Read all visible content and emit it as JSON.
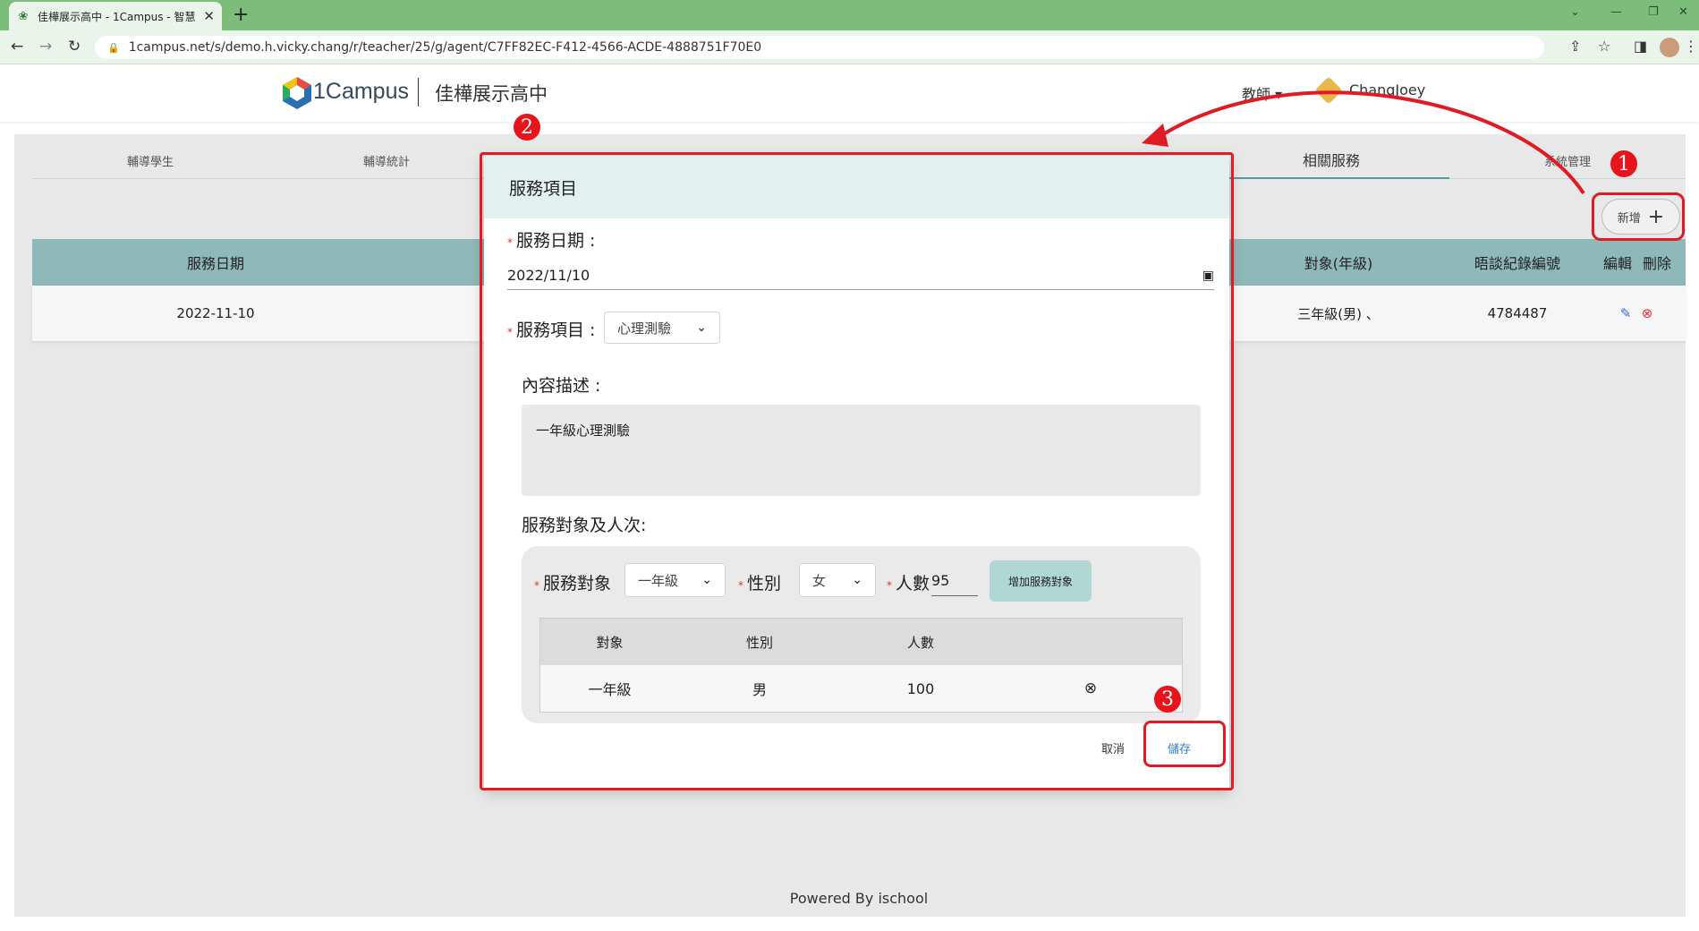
{
  "browser": {
    "tab_title": "佳樺展示高中 - 1Campus - 智慧",
    "tab_close": "✕",
    "new_tab": "+",
    "url": "1campus.net/s/demo.h.vicky.chang/r/teacher/25/g/agent/C7FF82EC-F412-4566-ACDE-4888751F70E0",
    "window_controls": [
      "⌄",
      "—",
      "❐",
      "✕"
    ]
  },
  "header": {
    "brand": "1Campus",
    "school": "佳樺展示高中",
    "role": "教師 ▾",
    "username": "ChangJoey"
  },
  "nav": {
    "tabs": [
      {
        "label": "輔導學生"
      },
      {
        "label": "輔導統計"
      },
      {
        "label": "…"
      },
      {
        "label": "…"
      },
      {
        "label": "…"
      },
      {
        "label": "相關服務"
      },
      {
        "label": "系統管理"
      }
    ]
  },
  "toolbar": {
    "add_label": "新增",
    "add_icon": "+"
  },
  "table": {
    "headers": [
      "服務日期",
      "對象(年級)",
      "晤談紀錄編號",
      "編輯",
      "刪除"
    ],
    "rows": [
      {
        "date": "2022-11-10",
        "target": "三年級(男) 、",
        "record_id": "4784487",
        "edit_icon": "✎",
        "delete_icon": "⊗"
      }
    ]
  },
  "modal": {
    "title": "服務項目",
    "date_label": "服務日期 :",
    "date_value": "2022/11/10",
    "service_label": "服務項目 :",
    "service_value": "心理測驗",
    "desc_label": "內容描述 :",
    "desc_value": "一年級心理測驗",
    "target_section_label": "服務對象及人次:",
    "target_label": "服務對象",
    "target_value": "一年級",
    "gender_label": "性別",
    "gender_value": "女",
    "count_label": "人數",
    "count_value": "95",
    "add_target_label": "增加服務對象",
    "inner_headers": [
      "對象",
      "性別",
      "人數"
    ],
    "inner_rows": [
      {
        "target": "一年級",
        "gender": "男",
        "count": "100",
        "remove_icon": "⊗"
      }
    ],
    "cancel_label": "取消",
    "save_label": "儲存"
  },
  "annotations": {
    "step1": "1",
    "step2": "2",
    "step3": "3",
    "color": "#e01b24"
  },
  "footer": {
    "text": "Powered By ischool"
  },
  "colors": {
    "browser_green": "#7cbd7c",
    "header_teal": "#8fb8b8",
    "modal_title_bg": "#e2f1ef",
    "add_target_bg": "#b1d7d3",
    "link_blue": "#2f7dd8"
  }
}
